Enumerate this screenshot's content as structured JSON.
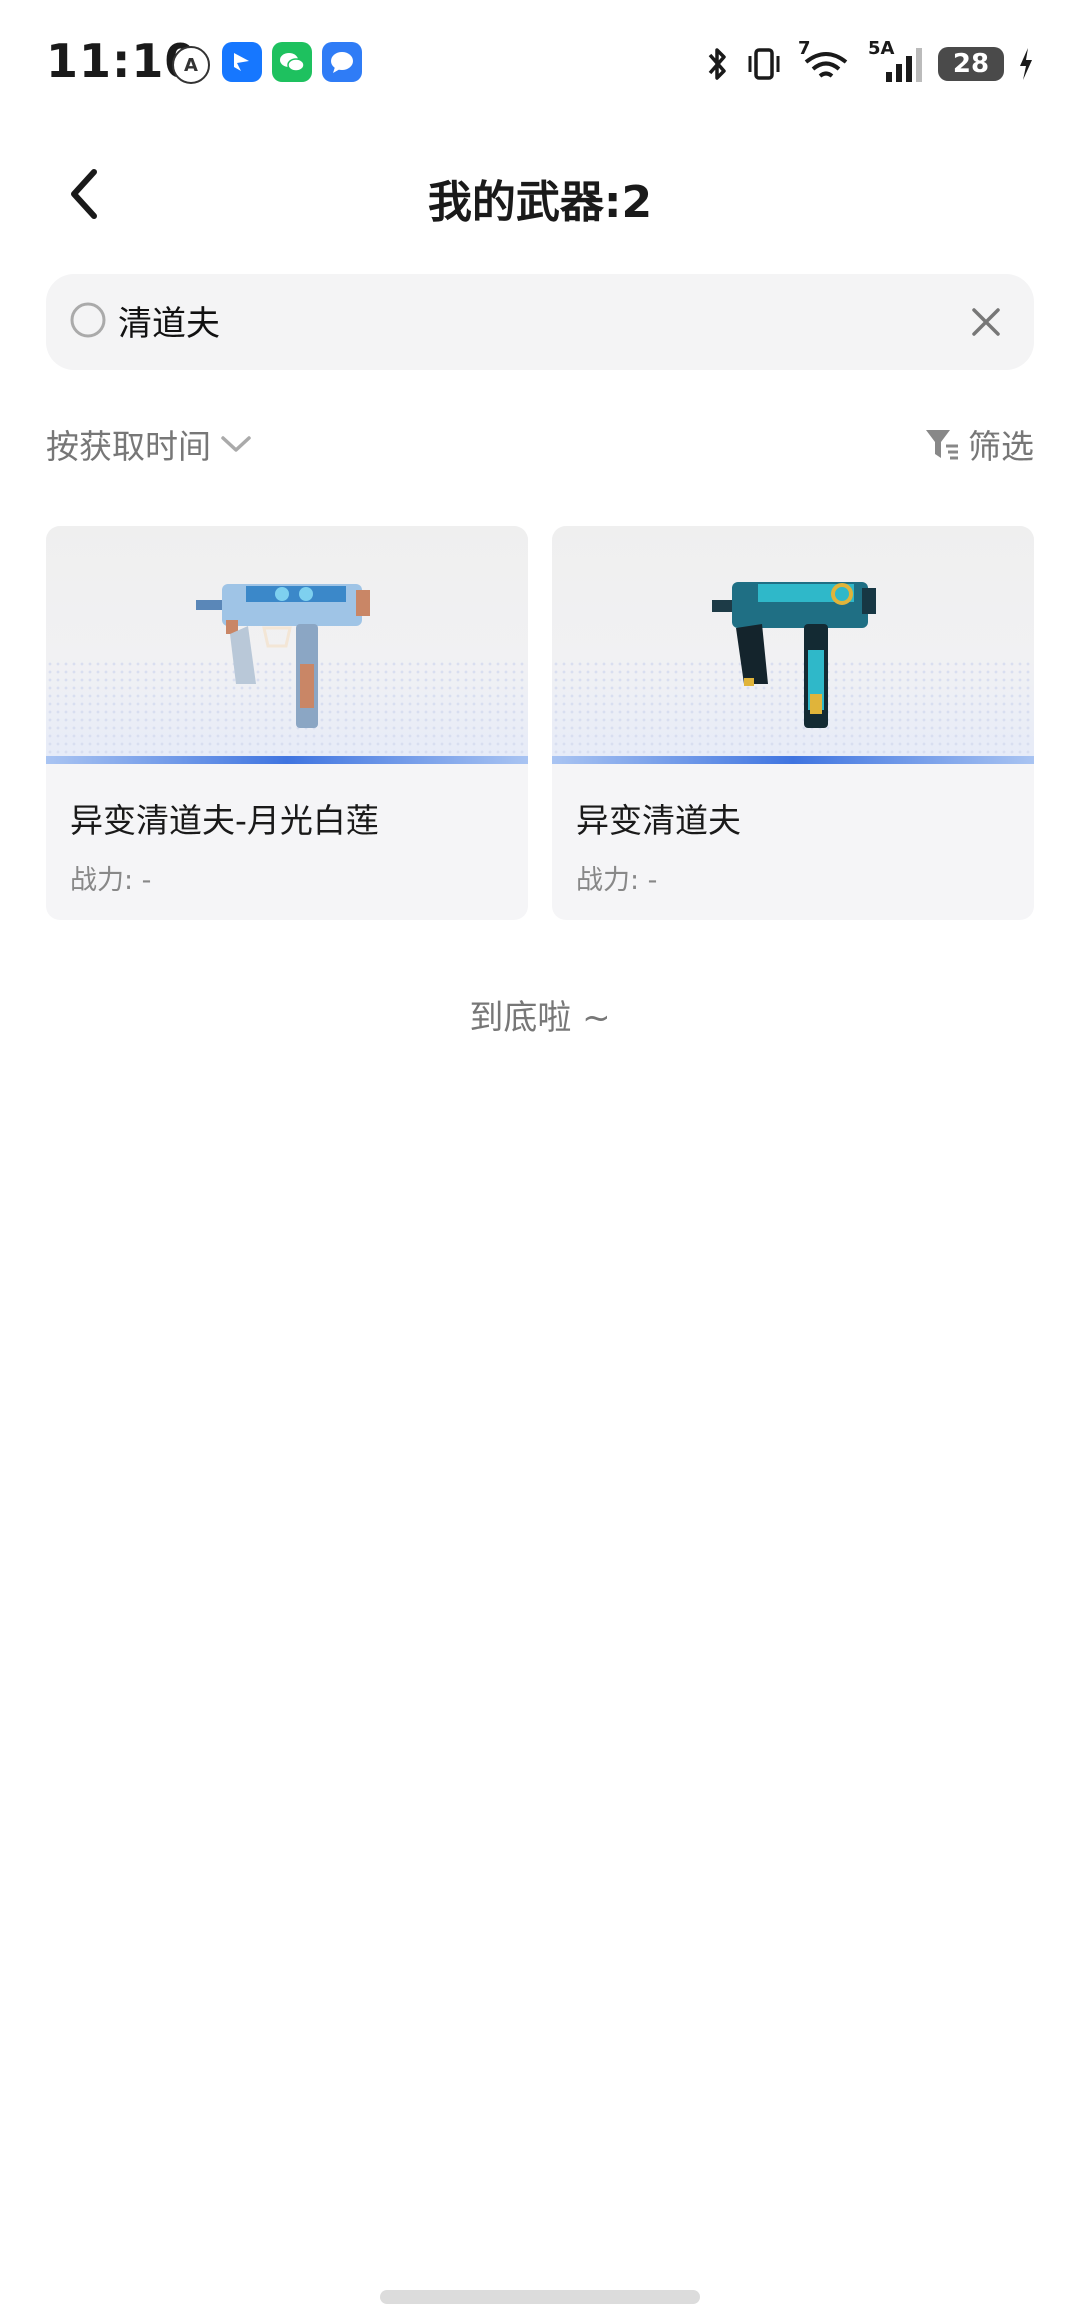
{
  "status_bar": {
    "time": "11:10",
    "network_label": "5A",
    "wifi_label": "7",
    "battery": "28"
  },
  "header": {
    "title": "我的武器:2"
  },
  "search": {
    "value": "清道夫"
  },
  "sort": {
    "label": "按获取时间"
  },
  "filter": {
    "label": "筛选"
  },
  "items": [
    {
      "name": "异变清道夫-月光白莲",
      "power": "战力: -"
    },
    {
      "name": "异变清道夫",
      "power": "战力: -"
    }
  ],
  "footer": {
    "end_text": "到底啦 ~"
  },
  "colors": {
    "accent_bar": "#3f74e0",
    "card_bg": "#f5f5f7",
    "search_bg": "#f4f4f5"
  }
}
